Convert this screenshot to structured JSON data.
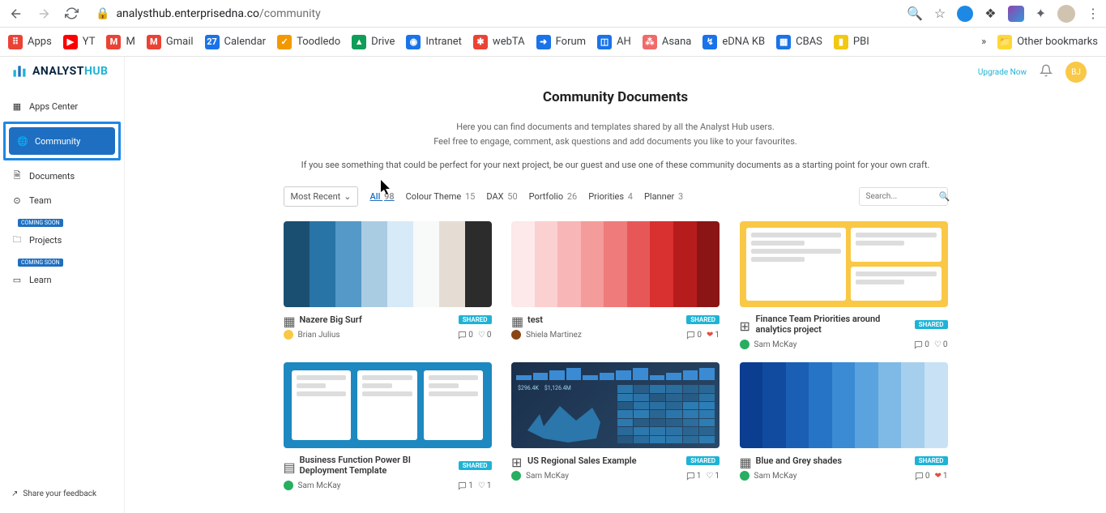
{
  "browser": {
    "url_host": "analysthub.enterprisedna.co",
    "url_path": "/community"
  },
  "bookmarks": [
    {
      "label": "Apps",
      "color": "#ea4335",
      "glyph": "⠿"
    },
    {
      "label": "YT",
      "color": "#ff0000",
      "glyph": "▶"
    },
    {
      "label": "M",
      "color": "#ea4335",
      "glyph": "M"
    },
    {
      "label": "Gmail",
      "color": "#ea4335",
      "glyph": "M"
    },
    {
      "label": "Calendar",
      "color": "#1a73e8",
      "glyph": "27"
    },
    {
      "label": "Toodledo",
      "color": "#f29900",
      "glyph": "✓"
    },
    {
      "label": "Drive",
      "color": "#0f9d58",
      "glyph": "▲"
    },
    {
      "label": "Intranet",
      "color": "#1a73e8",
      "glyph": "◉"
    },
    {
      "label": "webTA",
      "color": "#ea4335",
      "glyph": "✱"
    },
    {
      "label": "Forum",
      "color": "#1a73e8",
      "glyph": "➜"
    },
    {
      "label": "AH",
      "color": "#1a73e8",
      "glyph": "◫"
    },
    {
      "label": "Asana",
      "color": "#f06a6a",
      "glyph": "⁂"
    },
    {
      "label": "eDNA KB",
      "color": "#1a73e8",
      "glyph": "↯"
    },
    {
      "label": "CBAS",
      "color": "#1a73e8",
      "glyph": "▦"
    },
    {
      "label": "PBI",
      "color": "#f2c811",
      "glyph": "▮"
    }
  ],
  "bookmarks_more": "»",
  "other_bookmarks": "Other bookmarks",
  "logo": {
    "part1": "ANALYST",
    "part2": "HUB"
  },
  "sidebar": {
    "items": [
      {
        "label": "Apps Center",
        "icon": "grid"
      },
      {
        "label": "Community",
        "icon": "globe",
        "active": true
      },
      {
        "label": "Documents",
        "icon": "doc"
      },
      {
        "label": "Team",
        "icon": "team",
        "badge": "COMING SOON"
      },
      {
        "label": "Projects",
        "icon": "folder",
        "badge": "COMING SOON"
      },
      {
        "label": "Learn",
        "icon": "video"
      }
    ],
    "feedback": "Share your feedback"
  },
  "topbar": {
    "upgrade": "Upgrade Now",
    "avatar": "BJ"
  },
  "page": {
    "title": "Community Documents",
    "sub1": "Here you can find documents and templates shared by all the Analyst Hub users.",
    "sub2": "Feel free to engage, comment, ask questions and add documents you like to your favourites.",
    "note": "If you see something that could be perfect for your next project, be our guest and use one of these community documents as a starting point for your own craft."
  },
  "filters": {
    "sort": "Most Recent",
    "tabs": [
      {
        "label": "All",
        "count": "98",
        "active": true
      },
      {
        "label": "Colour Theme",
        "count": "15"
      },
      {
        "label": "DAX",
        "count": "50"
      },
      {
        "label": "Portfolio",
        "count": "26"
      },
      {
        "label": "Priorities",
        "count": "4"
      },
      {
        "label": "Planner",
        "count": "3"
      }
    ],
    "search_placeholder": "Search..."
  },
  "cards": [
    {
      "title": "Nazere Big Surf",
      "author": "Brian Julius",
      "author_color": "#f9c846",
      "shared": "SHARED",
      "type": "palette",
      "comments": "0",
      "likes": "0",
      "heart": false,
      "palette": [
        "#1b4f72",
        "#2874a6",
        "#5499c7",
        "#a9cce3",
        "#d6eaf8",
        "#f8f9f9",
        "#e5ddd4",
        "#2c2c2c"
      ]
    },
    {
      "title": "test",
      "author": "Shiela Martinez",
      "author_color": "#8b4513",
      "shared": "SHARED",
      "type": "palette",
      "comments": "0",
      "likes": "1",
      "heart": true,
      "palette": [
        "#fde9e9",
        "#fbd0d0",
        "#f8b6b6",
        "#f49b9b",
        "#ef7b7b",
        "#e85757",
        "#d93030",
        "#b71c1c",
        "#8b1515"
      ]
    },
    {
      "title": "Finance Team Priorities around analytics project",
      "author": "Sam McKay",
      "author_color": "#27ae60",
      "shared": "SHARED",
      "type": "priorities",
      "comments": "0",
      "likes": "0",
      "heart": false
    },
    {
      "title": "Business Function Power BI Deployment Template",
      "author": "Sam McKay",
      "author_color": "#27ae60",
      "shared": "SHARED",
      "type": "planner",
      "comments": "1",
      "likes": "1",
      "heart": false
    },
    {
      "title": "US Regional Sales Example",
      "author": "Sam McKay",
      "author_color": "#27ae60",
      "shared": "SHARED",
      "type": "dashboard",
      "comments": "1",
      "likes": "1",
      "heart": false
    },
    {
      "title": "Blue and Grey shades",
      "author": "Sam McKay",
      "author_color": "#27ae60",
      "shared": "SHARED",
      "type": "palette",
      "comments": "0",
      "likes": "1",
      "heart": true,
      "palette": [
        "#0b3d91",
        "#114b9f",
        "#1a5fb4",
        "#2574c6",
        "#3a8bd3",
        "#5ba3de",
        "#7fb9e6",
        "#a6cfee",
        "#c9e1f4"
      ]
    }
  ]
}
